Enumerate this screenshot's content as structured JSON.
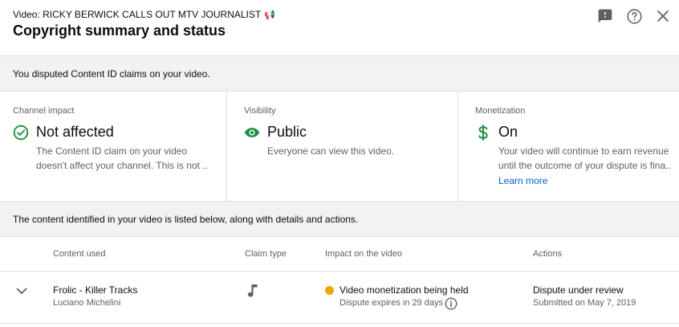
{
  "header": {
    "video_title": "Video: RICKY BERWICK CALLS OUT MTV JOURNALIST",
    "video_title_emoji": "📢",
    "page_title": "Copyright summary and status",
    "icons": [
      "feedback-icon",
      "help-icon",
      "close-icon"
    ]
  },
  "banner_top": {
    "text": "You disputed Content ID claims on your video."
  },
  "cards": [
    {
      "label": "Channel impact",
      "status": "Not affected",
      "icon": "check-circle-icon",
      "lines": [
        "The Content ID claim on your video",
        "doesn't affect your channel. This is not ..."
      ]
    },
    {
      "label": "Visibility",
      "status": "Public",
      "icon": "eye-icon",
      "lines": [
        "Everyone can view this video."
      ]
    },
    {
      "label": "Monetization",
      "status": "On",
      "icon": "dollar-icon",
      "lines": [
        "Your video will continue to earn revenue",
        "until the outcome of your dispute is fina..."
      ],
      "link": "Learn more"
    }
  ],
  "banner_bottom": {
    "text": "The content identified in your video is listed below, along with details and actions."
  },
  "table": {
    "columns": [
      "Content used",
      "Claim type",
      "Impact on the video",
      "Actions"
    ],
    "rows": [
      {
        "content_title": "Frolic - Killer Tracks",
        "content_artist": "Luciano Michelini",
        "claim_type_icon": "music-note-icon",
        "impact_title": "Video monetization being held",
        "impact_sub": "Dispute expires in 29 days",
        "action_title": "Dispute under review",
        "action_sub": "Submitted on May 7, 2019"
      }
    ]
  },
  "colors": {
    "green": "#1e8e3e",
    "status_dot": "#f2a600",
    "link": "#065fd4",
    "banner_bg": "#f2f2f2",
    "secondary_text": "#606060"
  }
}
